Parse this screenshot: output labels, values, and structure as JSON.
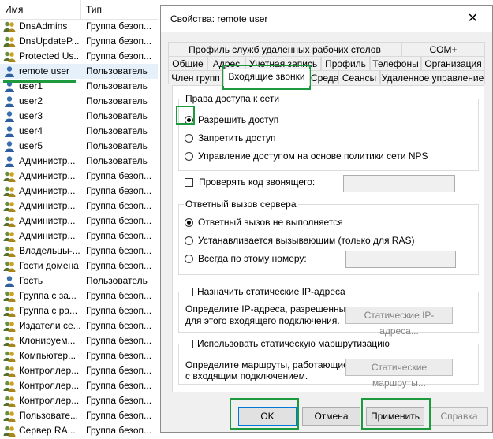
{
  "list": {
    "col_name": "Имя",
    "col_type": "Тип",
    "rows": [
      {
        "name": "DnsAdmins",
        "type": "Группа безоп...",
        "icon": "group-icon"
      },
      {
        "name": "DnsUpdateP...",
        "type": "Группа безоп...",
        "icon": "group-icon"
      },
      {
        "name": "Protected Us...",
        "type": "Группа безоп...",
        "icon": "group-icon"
      },
      {
        "name": "remote user",
        "type": "Пользователь",
        "icon": "user-icon"
      },
      {
        "name": "user1",
        "type": "Пользователь",
        "icon": "user-icon"
      },
      {
        "name": "user2",
        "type": "Пользователь",
        "icon": "user-icon"
      },
      {
        "name": "user3",
        "type": "Пользователь",
        "icon": "user-icon"
      },
      {
        "name": "user4",
        "type": "Пользователь",
        "icon": "user-icon"
      },
      {
        "name": "user5",
        "type": "Пользователь",
        "icon": "user-icon"
      },
      {
        "name": "Администр...",
        "type": "Пользователь",
        "icon": "user-icon"
      },
      {
        "name": "Администр...",
        "type": "Группа безоп...",
        "icon": "group-icon"
      },
      {
        "name": "Администр...",
        "type": "Группа безоп...",
        "icon": "group-icon"
      },
      {
        "name": "Администр...",
        "type": "Группа безоп...",
        "icon": "group-icon"
      },
      {
        "name": "Администр...",
        "type": "Группа безоп...",
        "icon": "group-icon"
      },
      {
        "name": "Администр...",
        "type": "Группа безоп...",
        "icon": "group-icon"
      },
      {
        "name": "Владельцы-...",
        "type": "Группа безоп...",
        "icon": "group-icon"
      },
      {
        "name": "Гости домена",
        "type": "Группа безоп...",
        "icon": "group-icon"
      },
      {
        "name": "Гость",
        "type": "Пользователь",
        "icon": "user-icon"
      },
      {
        "name": "Группа с за...",
        "type": "Группа безоп...",
        "icon": "group-icon"
      },
      {
        "name": "Группа с ра...",
        "type": "Группа безоп...",
        "icon": "group-icon"
      },
      {
        "name": "Издатели се...",
        "type": "Группа безоп...",
        "icon": "group-icon"
      },
      {
        "name": "Клонируем...",
        "type": "Группа безоп...",
        "icon": "group-icon"
      },
      {
        "name": "Компьютер...",
        "type": "Группа безоп...",
        "icon": "group-icon"
      },
      {
        "name": "Контроллер...",
        "type": "Группа безоп...",
        "icon": "group-icon"
      },
      {
        "name": "Контроллер...",
        "type": "Группа безоп...",
        "icon": "group-icon"
      },
      {
        "name": "Контроллер...",
        "type": "Группа безоп...",
        "icon": "group-icon"
      },
      {
        "name": "Пользовате...",
        "type": "Группа безоп...",
        "icon": "group-icon"
      },
      {
        "name": "Сервер RA...",
        "type": "Группа безоп...",
        "icon": "group-icon"
      }
    ]
  },
  "dialog": {
    "title": "Свойства: remote user",
    "close": "✕",
    "tabs_row1": [
      "Профиль служб удаленных рабочих столов",
      "COM+"
    ],
    "tabs_row2": [
      "Общие",
      "Адрес",
      "Учетная запись",
      "Профиль",
      "Телефоны",
      "Организация"
    ],
    "tabs_row3": [
      "Член групп",
      "Входящие звонки",
      "Среда",
      "Сеансы",
      "Удаленное управление"
    ],
    "network_access": {
      "caption": "Права доступа к сети",
      "allow": "Разрешить доступ",
      "deny": "Запретить доступ",
      "nps": "Управление доступом на основе политики сети NPS"
    },
    "verify_caller": "Проверять код звонящего:",
    "callback": {
      "caption": "Ответный вызов сервера",
      "no_callback": "Ответный вызов не выполняется",
      "set_by_caller": "Устанавливается вызывающим (только для RAS)",
      "always": "Всегда по этому номеру:"
    },
    "static_ip": {
      "check": "Назначить статические IP-адреса",
      "desc1": "Определите IP-адреса, разрешенные",
      "desc2": "для этого входящего подключения.",
      "button": "Статические IP-адреса..."
    },
    "static_routes": {
      "check": "Использовать статическую маршрутизацию",
      "desc1": "Определите маршруты, работающие",
      "desc2": "с входящим подключением.",
      "button": "Статические маршруты..."
    },
    "buttons": {
      "ok": "OK",
      "cancel": "Отмена",
      "apply": "Применить",
      "help": "Справка"
    }
  }
}
